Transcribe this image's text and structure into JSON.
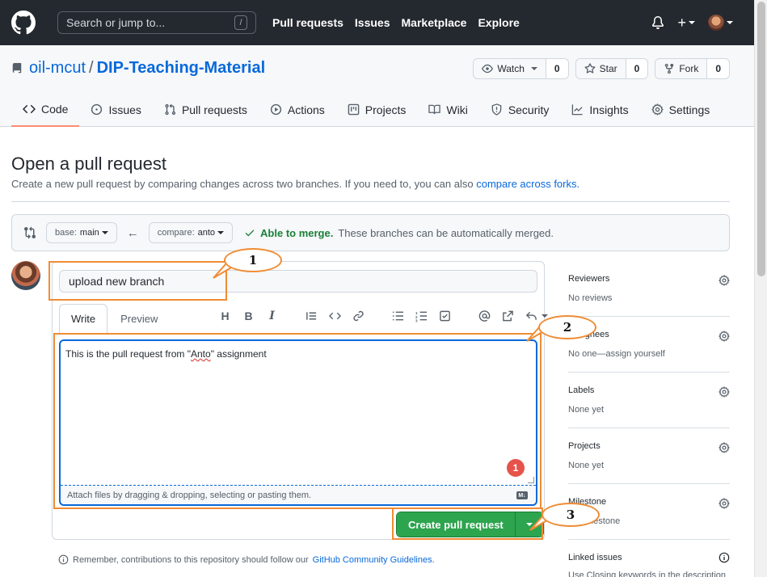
{
  "header": {
    "search_placeholder": "Search or jump to...",
    "search_shortcut": "/",
    "nav": [
      "Pull requests",
      "Issues",
      "Marketplace",
      "Explore"
    ],
    "plus": "+"
  },
  "repo": {
    "owner": "oil-mcut",
    "separator": "/",
    "name": "DIP-Teaching-Material",
    "watch_label": "Watch",
    "watch_count": "0",
    "star_label": "Star",
    "star_count": "0",
    "fork_label": "Fork",
    "fork_count": "0"
  },
  "tabs": [
    "Code",
    "Issues",
    "Pull requests",
    "Actions",
    "Projects",
    "Wiki",
    "Security",
    "Insights",
    "Settings"
  ],
  "page": {
    "title": "Open a pull request",
    "subtitle": "Create a new pull request by comparing changes across two branches. If you need to, you can also",
    "subtitle_link": "compare across forks."
  },
  "range": {
    "base_prefix": "base:",
    "base_branch": "main",
    "compare_prefix": "compare:",
    "compare_branch": "anto",
    "merge_ok": "Able to merge.",
    "merge_msg": "These branches can be automatically merged."
  },
  "form": {
    "title_value": "upload new branch",
    "tab_write": "Write",
    "tab_preview": "Preview",
    "body_before": "This is the pull request from \"",
    "body_word": "Anto",
    "body_after": "\" assignment",
    "attach_text": "Attach files by dragging & dropping, selecting or pasting them.",
    "error_count": "1",
    "md_label": "M↓",
    "create_label": "Create pull request"
  },
  "note": {
    "text": "Remember, contributions to this repository should follow our",
    "link": "GitHub Community Guidelines."
  },
  "sidebar": [
    {
      "label": "Reviewers",
      "value": "No reviews"
    },
    {
      "label": "Assignees",
      "value": "No one—assign yourself"
    },
    {
      "label": "Labels",
      "value": "None yet"
    },
    {
      "label": "Projects",
      "value": "None yet"
    },
    {
      "label": "Milestone",
      "value": "No milestone"
    }
  ],
  "sidebar_last": {
    "label": "Linked issues",
    "value": "Use Closing keywords in the description"
  },
  "annotations": [
    "1",
    "2",
    "3"
  ],
  "colors": {
    "accent": "#0969da",
    "green": "#2da44e",
    "annotation": "#ef8c34",
    "header": "#24292f"
  }
}
